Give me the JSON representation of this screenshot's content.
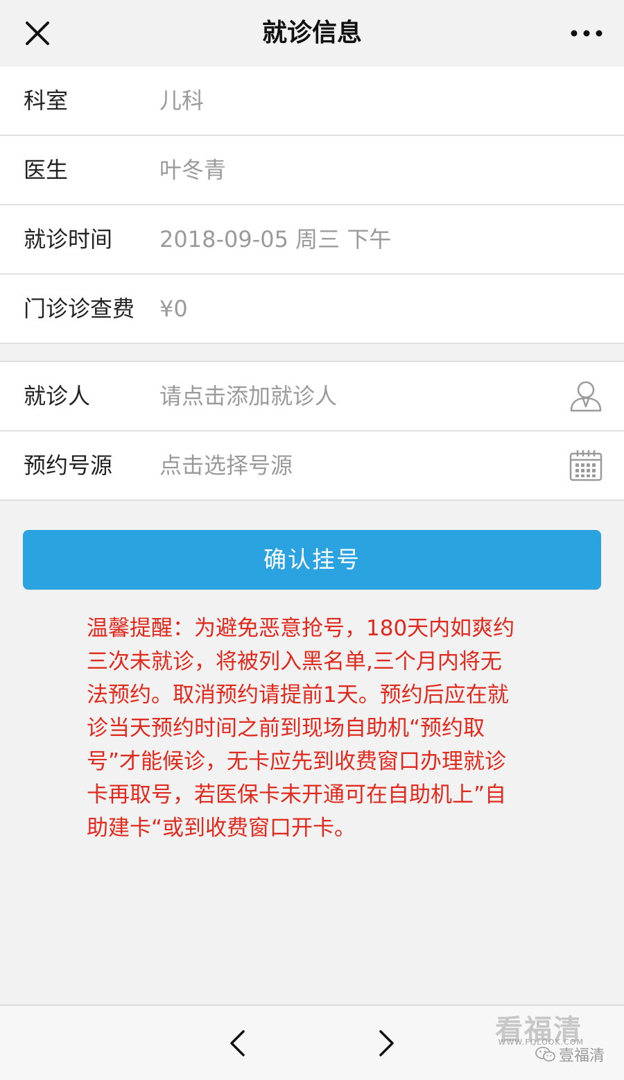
{
  "header": {
    "title": "就诊信息"
  },
  "info": [
    {
      "label": "科室",
      "value": "儿科"
    },
    {
      "label": "医生",
      "value": "叶冬青"
    },
    {
      "label": "就诊时间",
      "value": "2018-09-05 周三 下午"
    },
    {
      "label": "门诊诊查费",
      "value": "¥0"
    }
  ],
  "patient": {
    "label": "就诊人",
    "placeholder": "请点击添加就诊人",
    "icon": "person-icon"
  },
  "source": {
    "label": "预约号源",
    "placeholder": "点击选择号源",
    "icon": "calendar-icon"
  },
  "confirm": {
    "label": "确认挂号"
  },
  "notice": {
    "lines": [
      "温馨提醒：为避免恶意抢号，180天内如爽约",
      "三次未就诊，将被列入黑名单,三个月内将无",
      "法预约。取消预约请提前1天。预约后应在就",
      "诊当天预约时间之前到现场自助机“预约取",
      "号”才能候诊，无卡应先到收费窗口办理就诊",
      "卡再取号，若医保卡未开通可在自助机上”自",
      "助建卡“或到收费窗口开卡。"
    ],
    "color": "#e02a1e"
  },
  "watermark": {
    "main": "看福清",
    "url": "WWW.FQLOOK.COM",
    "account": "壹福清"
  },
  "colors": {
    "accent": "#2aa3e0",
    "warning": "#e02a1e"
  }
}
